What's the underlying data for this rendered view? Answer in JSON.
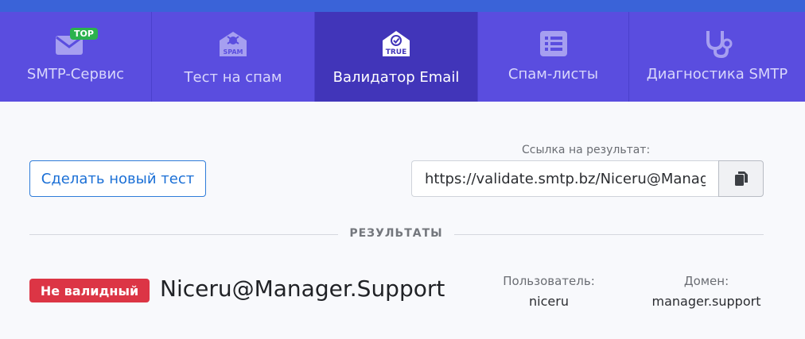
{
  "tabs": [
    {
      "label": "SMTP-Сервис",
      "icon": "envelope-icon",
      "badge": "TOP"
    },
    {
      "label": "Тест на спам",
      "icon": "spam-envelope-icon",
      "icon_text": "SPAM"
    },
    {
      "label": "Валидатор Email",
      "icon": "true-envelope-icon",
      "icon_text": "TRUE",
      "active": true
    },
    {
      "label": "Спам-листы",
      "icon": "list-icon"
    },
    {
      "label": "Диагностика SMTP",
      "icon": "stethoscope-icon"
    }
  ],
  "actions": {
    "new_test_label": "Сделать новый тест"
  },
  "result_link": {
    "label": "Ссылка на результат:",
    "value": "https://validate.smtp.bz/Niceru@Manager.Support",
    "copy_icon": "copy-icon"
  },
  "results": {
    "heading": "РЕЗУЛЬТАТЫ",
    "status": "Не валидный",
    "email": "Niceru@Manager.Support",
    "user_label": "Пользователь:",
    "user_value": "niceru",
    "domain_label": "Домен:",
    "domain_value": "manager.support"
  },
  "colors": {
    "nav_bg": "#5a4ddf",
    "nav_active": "#4135b9",
    "top_stripe": "#3a63d8",
    "badge_green": "#2bb24c",
    "status_red": "#dc3545",
    "link_blue": "#1a6fd6"
  }
}
